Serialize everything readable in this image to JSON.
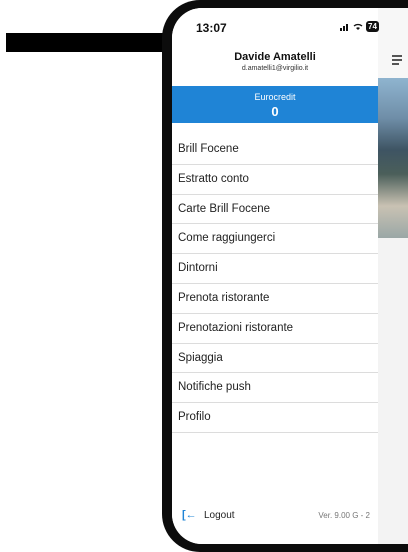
{
  "status_bar": {
    "time": "13:07",
    "signal": "📶",
    "wifi": "wifi",
    "battery": "74"
  },
  "user": {
    "name": "Davide Amatelli",
    "email": "d.amatelli1@virgilio.it"
  },
  "credit": {
    "label": "Eurocredit",
    "value": "0"
  },
  "menu": [
    "Brill Focene",
    "Estratto conto",
    "Carte Brill Focene",
    "Come raggiungerci",
    "Dintorni",
    "Prenota ristorante",
    "Prenotazioni ristorante",
    "Spiaggia",
    "Notifiche push",
    "Profilo"
  ],
  "footer": {
    "logout_label": "Logout",
    "version": "Ver. 9.00 G - 2"
  },
  "colors": {
    "accent": "#1f84d6"
  }
}
